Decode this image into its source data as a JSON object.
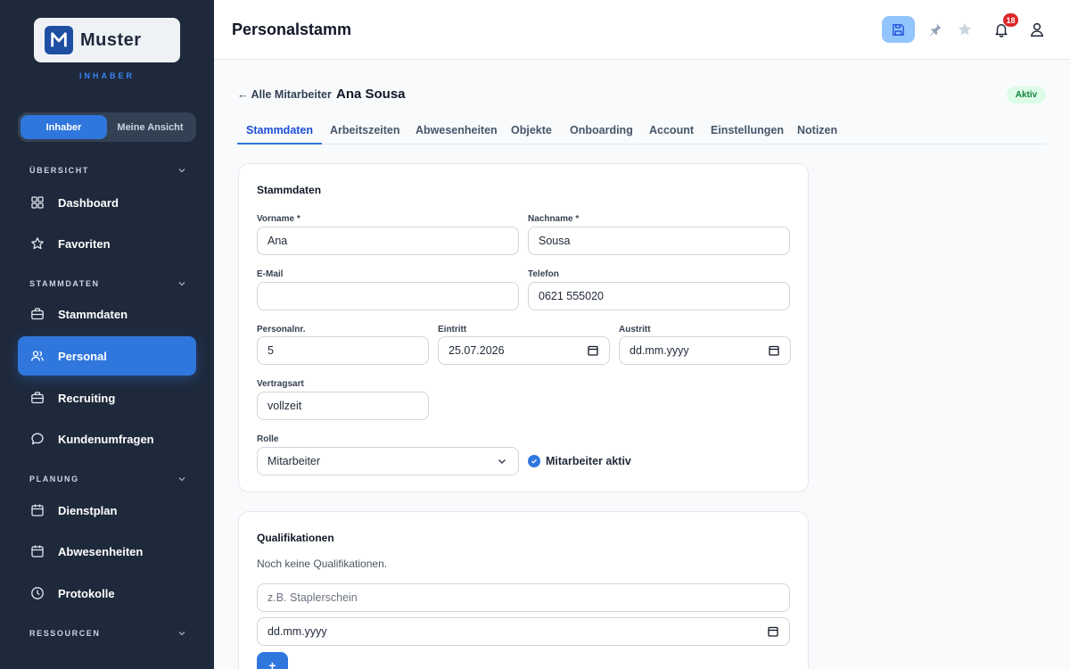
{
  "brand": {
    "name": "Muster",
    "subtitle": "INHABER",
    "logo_icon": "m-logo-icon"
  },
  "view_toggle": {
    "options": [
      "Inhaber",
      "Meine Ansicht"
    ],
    "active": "Inhaber"
  },
  "sidebar": {
    "sections": [
      {
        "label": "ÜBERSICHT"
      },
      {
        "label": "STAMMDATEN"
      },
      {
        "label": "PLANUNG"
      },
      {
        "label": "RESSOURCEN"
      }
    ],
    "items": [
      {
        "label": "Dashboard",
        "icon": "grid-icon"
      },
      {
        "label": "Favoriten",
        "icon": "star-icon"
      },
      {
        "label": "Stammdaten",
        "icon": "briefcase-icon"
      },
      {
        "label": "Personal",
        "icon": "users-icon",
        "active": true
      },
      {
        "label": "Recruiting",
        "icon": "briefcase-icon"
      },
      {
        "label": "Kundenumfragen",
        "icon": "chat-bubble-icon"
      },
      {
        "label": "Dienstplan",
        "icon": "calendar-icon"
      },
      {
        "label": "Abwesenheiten",
        "icon": "calendar-icon"
      },
      {
        "label": "Protokolle",
        "icon": "clock-icon"
      }
    ]
  },
  "header": {
    "title": "Personalstamm",
    "notification_count": "18",
    "icons": [
      "save-icon",
      "pin-icon",
      "star-icon",
      "bell-icon",
      "user-icon"
    ]
  },
  "employee": {
    "back_label": "← Alle Mitarbeiter",
    "name": "Ana Sousa",
    "status": "Aktiv"
  },
  "tabs": [
    "Stammdaten",
    "Arbeitszeiten",
    "Abwesenheiten",
    "Objekte",
    "Onboarding",
    "Account",
    "Einstellungen",
    "Notizen"
  ],
  "active_tab": "Stammdaten",
  "stammdaten": {
    "title": "Stammdaten",
    "vorname": {
      "label": "Vorname *",
      "value": "Ana"
    },
    "nachname": {
      "label": "Nachname *",
      "value": "Sousa"
    },
    "email": {
      "label": "E-Mail",
      "value": ""
    },
    "telefon": {
      "label": "Telefon",
      "value": "0621 555020"
    },
    "personalnr": {
      "label": "Personalnr.",
      "value": "5"
    },
    "eintritt": {
      "label": "Eintritt",
      "value": "25.07.2026"
    },
    "austritt": {
      "label": "Austritt",
      "placeholder": "dd.mm.yyyy"
    },
    "vertragsart": {
      "label": "Vertragsart",
      "value": "vollzeit"
    },
    "rolle": {
      "label": "Rolle",
      "value": "Mitarbeiter"
    },
    "aktiv": {
      "label": "Mitarbeiter aktiv",
      "checked": true
    }
  },
  "qualifikationen": {
    "title": "Qualifikationen",
    "empty_text": "Noch keine Qualifikationen.",
    "name_placeholder": "z.B. Staplerschein",
    "date_placeholder": "dd.mm.yyyy",
    "add_label": "+"
  },
  "colors": {
    "sidebar_bg": "#1e293b",
    "accent": "#2f76dd",
    "active_status": "#15803d",
    "badge": "#dc2626"
  }
}
